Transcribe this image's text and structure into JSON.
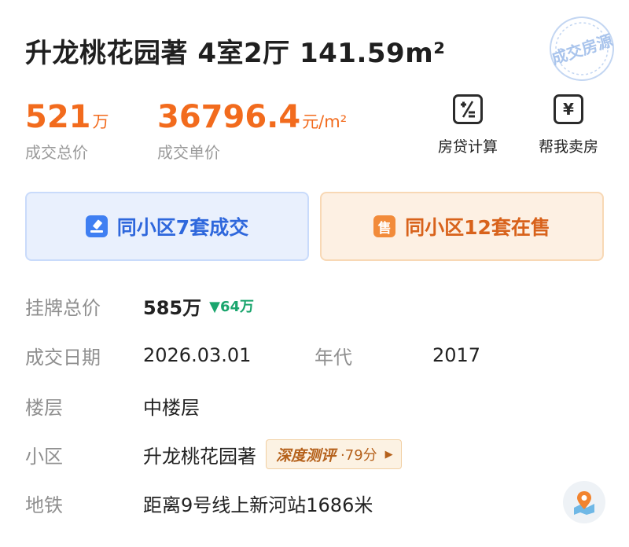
{
  "header": {
    "title": "升龙桃花园著 4室2厅 141.59m²"
  },
  "stamp": {
    "text": "成交房源",
    "color": "#a9c4ec"
  },
  "price": {
    "total_value": "521",
    "total_unit": "万",
    "total_caption": "成交总价",
    "unit_value": "36796.4",
    "unit_unit": "元/m²",
    "unit_caption": "成交单价"
  },
  "tools": {
    "calc": {
      "label": "房贷计算",
      "icon": "calculator-icon"
    },
    "sell": {
      "label": "帮我卖房",
      "icon": "yuan-icon"
    }
  },
  "cards": {
    "sold": {
      "label": "同小区7套成交",
      "icon": "gavel-icon"
    },
    "onsale": {
      "label": "同小区12套在售",
      "icon": "sale-tag-icon",
      "icon_text": "售"
    }
  },
  "details": {
    "list_price": {
      "key": "挂牌总价",
      "value": "585万",
      "drop": "▼64万"
    },
    "deal_date": {
      "key": "成交日期",
      "value": "2026.03.01"
    },
    "year": {
      "key": "年代",
      "value": "2017"
    },
    "floor": {
      "key": "楼层",
      "value": "中楼层"
    },
    "community": {
      "key": "小区",
      "value": "升龙桃花园著",
      "badge_title": "深度测评",
      "badge_score": "·79分",
      "badge_arrow": "▶"
    },
    "metro": {
      "key": "地铁",
      "value": "距离9号线上新河站1686米"
    }
  },
  "colors": {
    "accent_orange": "#f26b1d",
    "blue": "#2e67dc",
    "green_drop": "#1aa56d"
  }
}
